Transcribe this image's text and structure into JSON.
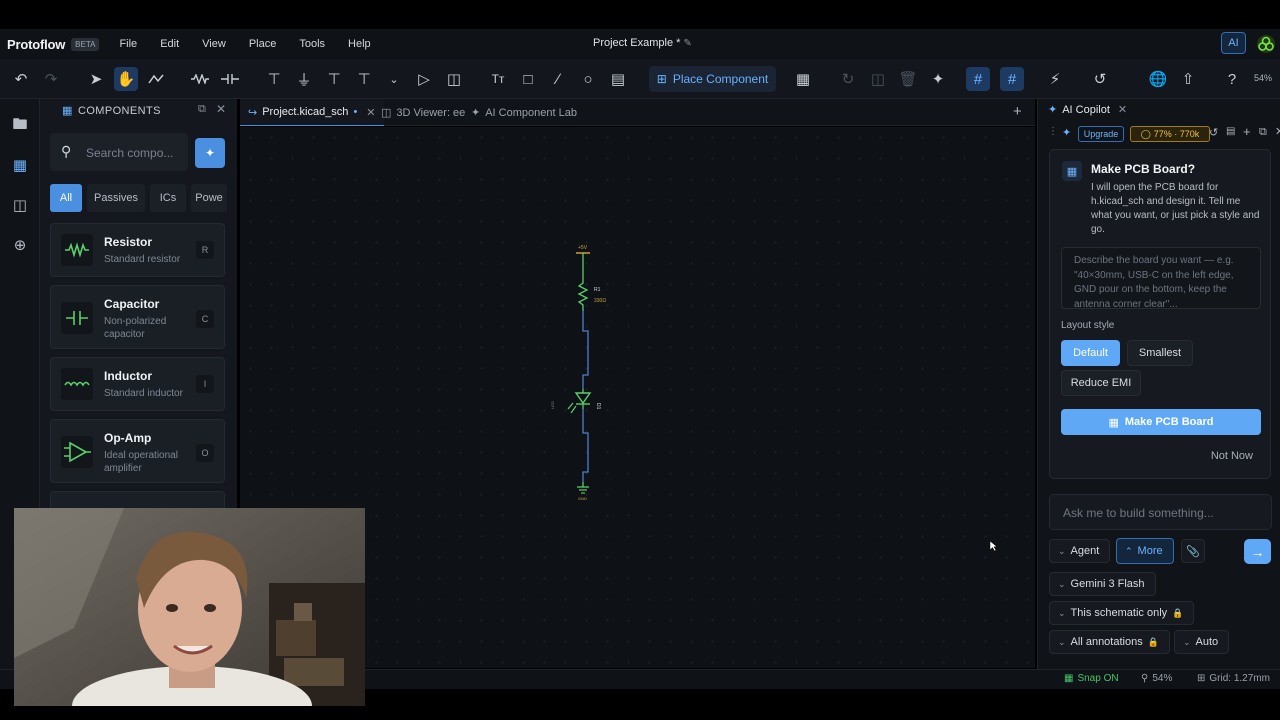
{
  "app": {
    "brand": "Protoflow",
    "beta": "BETA",
    "project_title": "Project Example *",
    "ai_button": "AI"
  },
  "menu": [
    "File",
    "Edit",
    "View",
    "Place",
    "Tools",
    "Help"
  ],
  "toolbar": {
    "place_component": "Place Component",
    "zoom": "54%"
  },
  "components_panel": {
    "header": "COMPONENTS",
    "search_placeholder": "Search compo...",
    "filters": [
      "All",
      "Passives",
      "ICs",
      "Powe"
    ],
    "active_filter": "All",
    "items": [
      {
        "name": "Resistor",
        "desc": "Standard resistor",
        "key": "R"
      },
      {
        "name": "Capacitor",
        "desc": "Non-polarized capacitor",
        "key": "C"
      },
      {
        "name": "Inductor",
        "desc": "Standard inductor",
        "key": "I"
      },
      {
        "name": "Op-Amp",
        "desc": "Ideal operational amplifier",
        "key": "O"
      }
    ]
  },
  "tabs": [
    {
      "label": "Project.kicad_sch",
      "modified": "•",
      "active": true
    },
    {
      "label": "3D Viewer: ee",
      "active": false
    },
    {
      "label": "AI Component Lab",
      "active": false
    }
  ],
  "schematic": {
    "power_label": "+5V",
    "resistor_ref": "R1",
    "resistor_value": "330Ω",
    "led_ref": "D1",
    "led_value": "LED",
    "gnd_label": "GND"
  },
  "copilot": {
    "tab_label": "AI Copilot",
    "upgrade": "Upgrade",
    "tokens": "77% · 770k",
    "card": {
      "title": "Make PCB Board?",
      "body": "I will open the PCB board for h.kicad_sch and design it. Tell me what you want, or just pick a style and go.",
      "placeholder": "Describe the board you want — e.g. \"40×30mm, USB-C on the left edge, GND pour on the bottom, keep the antenna corner clear\"...",
      "layout_label": "Layout style",
      "styles": [
        "Default",
        "Smallest",
        "Reduce EMI"
      ],
      "make_button": "Make PCB Board",
      "not_now": "Not Now"
    },
    "ask_placeholder": "Ask me to build something...",
    "agent": "Agent",
    "more": "More",
    "model": "Gemini 3 Flash",
    "scope": "This schematic only",
    "annotations": "All annotations",
    "auto": "Auto"
  },
  "status": {
    "snap": "Snap ON",
    "zoom": "54%",
    "grid": "Grid: 1.27mm"
  },
  "colors": {
    "accent": "#4a8fe0",
    "schematic_green": "#59d06a",
    "wire_blue": "#4f7fc9"
  }
}
